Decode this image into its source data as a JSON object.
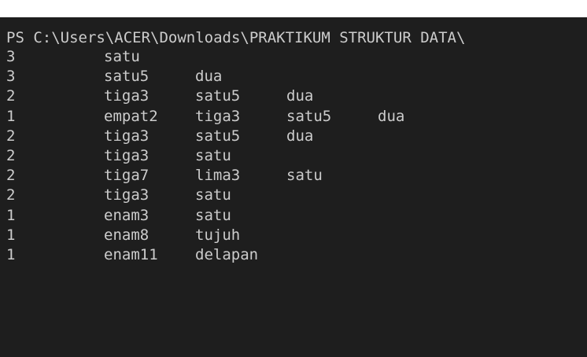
{
  "terminal": {
    "prompt": "PS C:\\Users\\ACER\\Downloads\\PRAKTIKUM STRUKTUR DATA\\",
    "rows": [
      {
        "count": "3",
        "items": [
          "satu"
        ]
      },
      {
        "count": "3",
        "items": [
          "satu5",
          "dua"
        ]
      },
      {
        "count": "2",
        "items": [
          "tiga3",
          "satu5",
          "dua"
        ]
      },
      {
        "count": "1",
        "items": [
          "empat2",
          "tiga3",
          "satu5",
          "dua"
        ]
      },
      {
        "count": "2",
        "items": [
          "tiga3",
          "satu5",
          "dua"
        ]
      },
      {
        "count": "2",
        "items": [
          "tiga3",
          "satu"
        ]
      },
      {
        "count": "2",
        "items": [
          "tiga7",
          "lima3",
          "satu"
        ]
      },
      {
        "count": "2",
        "items": [
          "tiga3",
          "satu"
        ]
      },
      {
        "count": "1",
        "items": [
          "enam3",
          "satu"
        ]
      },
      {
        "count": "1",
        "items": [
          "enam8",
          "tujuh"
        ]
      },
      {
        "count": "1",
        "items": [
          "enam11",
          "delapan"
        ]
      }
    ]
  }
}
